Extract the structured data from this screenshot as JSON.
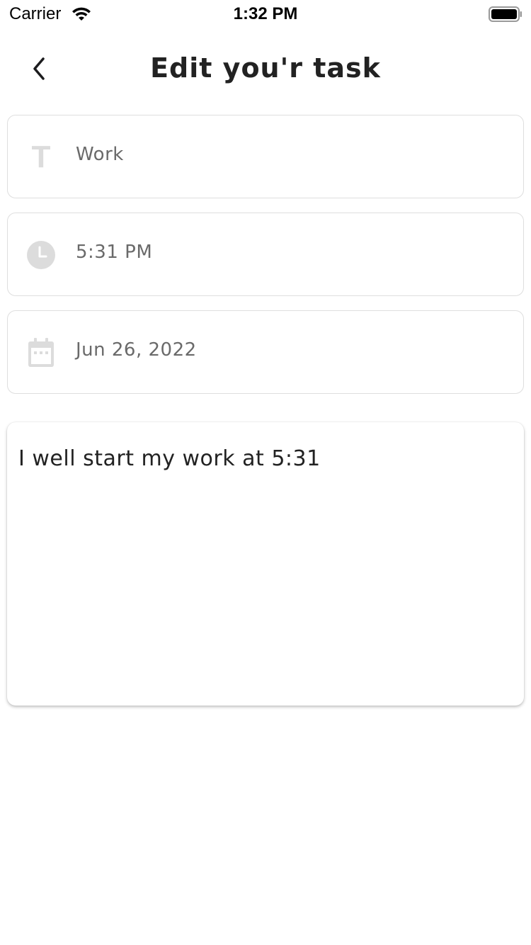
{
  "status_bar": {
    "carrier": "Carrier",
    "time": "1:32 PM"
  },
  "header": {
    "title": "Edit you'r task",
    "back_icon": "chevron-left-icon"
  },
  "fields": {
    "title": {
      "icon": "text-t-icon",
      "value": "Work"
    },
    "time": {
      "icon": "clock-icon",
      "value": "5:31 PM"
    },
    "date": {
      "icon": "calendar-icon",
      "value": "Jun 26, 2022"
    }
  },
  "description": {
    "value": "I well start my work at 5:31"
  },
  "colors": {
    "icon_gray": "#dcdcdc",
    "border": "#dedede",
    "value_text": "#6a6a6a"
  }
}
